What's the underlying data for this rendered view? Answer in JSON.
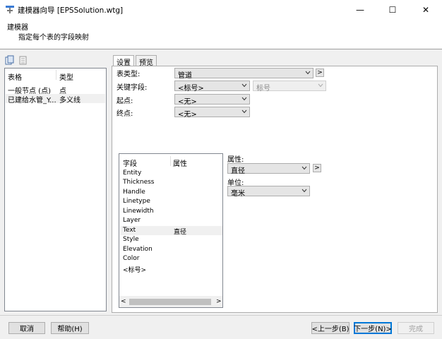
{
  "window": {
    "title": "建模器向导 [EPSSolution.wtg]",
    "minimize": "—",
    "maximize": "☐",
    "close": "✕"
  },
  "header": {
    "title": "建模器",
    "subtitle": "指定每个表的字段映射"
  },
  "left": {
    "col_table": "表格",
    "col_type": "类型",
    "rows": [
      {
        "table": "一般节点 (点)",
        "type": "点"
      },
      {
        "table": "已建给水管_Y...",
        "type": "多义线"
      }
    ]
  },
  "tabs": [
    {
      "label": "设置"
    },
    {
      "label": "预览"
    }
  ],
  "settings": {
    "table_type_label": "表类型:",
    "table_type_value": "管道",
    "key_field_label": "关键字段:",
    "key_field_value": "<标号>",
    "key_field_value2": "标号",
    "start_label": "起点:",
    "start_value": "<无>",
    "end_label": "终点:",
    "end_value": "<无>",
    "more_btn": ">"
  },
  "fields": {
    "col_field": "字段",
    "col_attr": "属性",
    "rows": [
      {
        "field": "Entity",
        "attr": ""
      },
      {
        "field": "Thickness",
        "attr": ""
      },
      {
        "field": "Handle",
        "attr": ""
      },
      {
        "field": "Linetype",
        "attr": ""
      },
      {
        "field": "Linewidth",
        "attr": ""
      },
      {
        "field": "Layer",
        "attr": ""
      },
      {
        "field": "Text",
        "attr": "直径"
      },
      {
        "field": "Style",
        "attr": ""
      },
      {
        "field": "Elevation",
        "attr": ""
      },
      {
        "field": "Color",
        "attr": ""
      },
      {
        "field": "<标号>",
        "attr": ""
      }
    ],
    "scroll_left": "<",
    "scroll_right": ">"
  },
  "property": {
    "attr_label": "属性:",
    "attr_value": "直径",
    "unit_label": "单位:",
    "unit_value": "毫米",
    "more_btn": ">"
  },
  "buttons": {
    "cancel": "取消",
    "help": "帮助(H)",
    "back": "<上一步(B)",
    "next": "下一步(N)>",
    "finish": "完成"
  },
  "colors": {
    "accent": "#0078d7",
    "selected_row": "#f0f0f0"
  }
}
